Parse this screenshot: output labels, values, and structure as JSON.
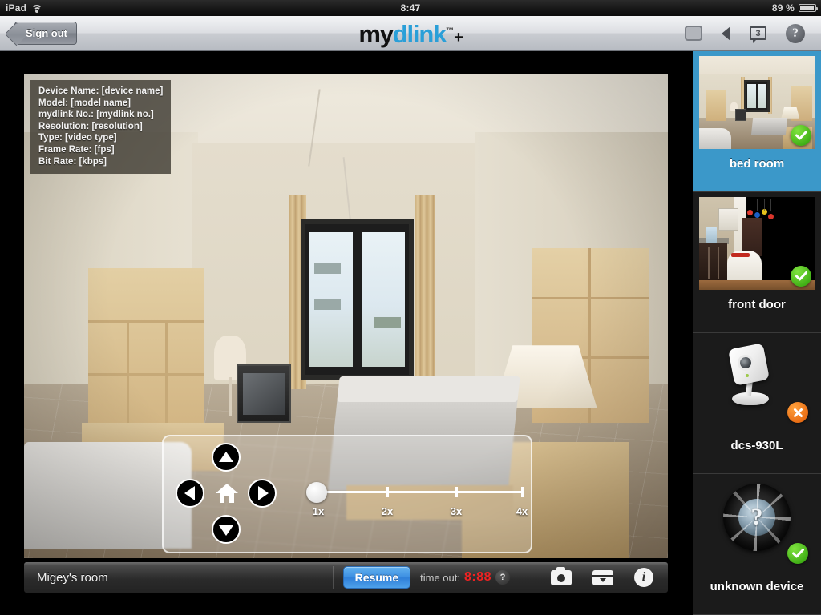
{
  "status_bar": {
    "carrier": "iPad",
    "wifi_icon": "wifi-icon",
    "time": "8:47",
    "battery_percent": "89 %",
    "battery_icon": "battery-icon"
  },
  "navbar": {
    "sign_out_label": "Sign out",
    "logo": {
      "part1": "my",
      "part2": "dlink",
      "trademark": "™",
      "plus": "+"
    },
    "icons": [
      {
        "name": "screen-icon",
        "label": ""
      },
      {
        "name": "speaker-icon",
        "label": ""
      },
      {
        "name": "messages-icon",
        "label": "3"
      },
      {
        "name": "help-icon",
        "label": "?"
      }
    ]
  },
  "video_overlay": {
    "lines": [
      "Device Name: [device name]",
      "Model: [model name]",
      "mydlink No.: [mydlink no.]",
      "Resolution: [resolution]",
      "Type: [video type]",
      "Frame Rate: [fps]",
      "Bit Rate: [kbps]"
    ]
  },
  "ptz": {
    "up_label": "up-arrow",
    "down_label": "down-arrow",
    "left_label": "left-arrow",
    "right_label": "right-arrow",
    "home_label": "home",
    "zoom": {
      "ticks": [
        "1x",
        "2x",
        "3x",
        "4x"
      ],
      "current": "1x",
      "handle_position_percent": 0
    }
  },
  "bottom_bar": {
    "camera_name": "Migey's room",
    "resume_label": "Resume",
    "timeout_label": "time out:",
    "timeout_value": "8:88",
    "timeout_help": "?",
    "actions": [
      {
        "name": "snapshot-icon"
      },
      {
        "name": "record-icon"
      },
      {
        "name": "info-icon",
        "label": "i"
      }
    ]
  },
  "sidebar": {
    "devices": [
      {
        "name": "bed room",
        "status": "online",
        "badge": "check",
        "selected": true,
        "kind": "thumbnail-bedroom"
      },
      {
        "name": "front door",
        "status": "online",
        "badge": "check",
        "selected": false,
        "kind": "thumbnail-frontdoor"
      },
      {
        "name": "dcs-930L",
        "status": "offline",
        "badge": "cross",
        "selected": false,
        "kind": "product-camera"
      },
      {
        "name": "unknown device",
        "status": "online",
        "badge": "check",
        "selected": false,
        "kind": "unknown-lens"
      }
    ]
  },
  "colors": {
    "brand_blue": "#2a9fd8",
    "selected_blue": "#3b98c9",
    "resume_blue": "#3d8fe2",
    "status_ok_green": "#2a9c07",
    "status_err_orange": "#e05a05",
    "timeout_red": "#ef2222"
  }
}
